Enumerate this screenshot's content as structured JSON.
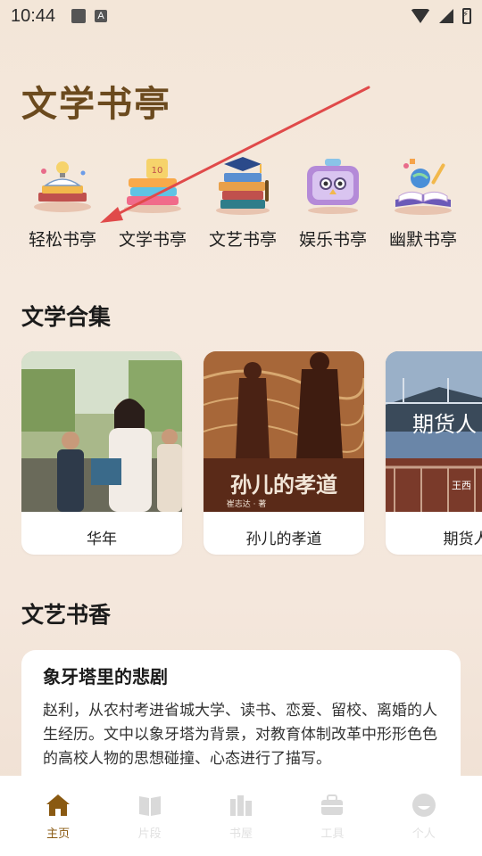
{
  "status_bar": {
    "time": "10:44",
    "left_icons": [
      "image-icon",
      "text-a-icon"
    ],
    "right_icons": [
      "wifi-icon",
      "signal-icon",
      "battery-charging-icon"
    ]
  },
  "header": {
    "title": "文学书亭"
  },
  "pavilions": [
    {
      "label": "轻松书亭",
      "icon": "books-with-lightbulb-icon"
    },
    {
      "label": "文学书亭",
      "icon": "stacked-books-icon"
    },
    {
      "label": "文艺书亭",
      "icon": "books-with-cap-icon"
    },
    {
      "label": "娱乐书亭",
      "icon": "robot-monitor-icon"
    },
    {
      "label": "幽默书亭",
      "icon": "open-book-globe-icon"
    }
  ],
  "collection_section": {
    "title": "文学合集",
    "cards": [
      {
        "caption": "华年"
      },
      {
        "caption": "孙儿的孝道",
        "cover_title": "孙儿的孝道",
        "cover_author": "崔志达 · 著"
      },
      {
        "caption": "期货人",
        "cover_title": "期货人",
        "cover_author": "王西"
      }
    ]
  },
  "article_section": {
    "title": "文艺书香",
    "article": {
      "title": "象牙塔里的悲剧",
      "body": "赵利，从农村考进省城大学、读书、恋爱、留校、离婚的人生经历。文中以象牙塔为背景，对教育体制改革中形形色色的高校人物的思想碰撞、心态进行了描写。"
    }
  },
  "bottom_nav": {
    "items": [
      {
        "label": "主页",
        "active": true
      },
      {
        "label": "片段",
        "active": false
      },
      {
        "label": "书屋",
        "active": false
      },
      {
        "label": "工具",
        "active": false
      },
      {
        "label": "个人",
        "active": false
      }
    ]
  },
  "colors": {
    "title_brown": "#6b4a1e",
    "active_nav": "#8a5a12",
    "annotation_arrow": "#e04a4a"
  }
}
